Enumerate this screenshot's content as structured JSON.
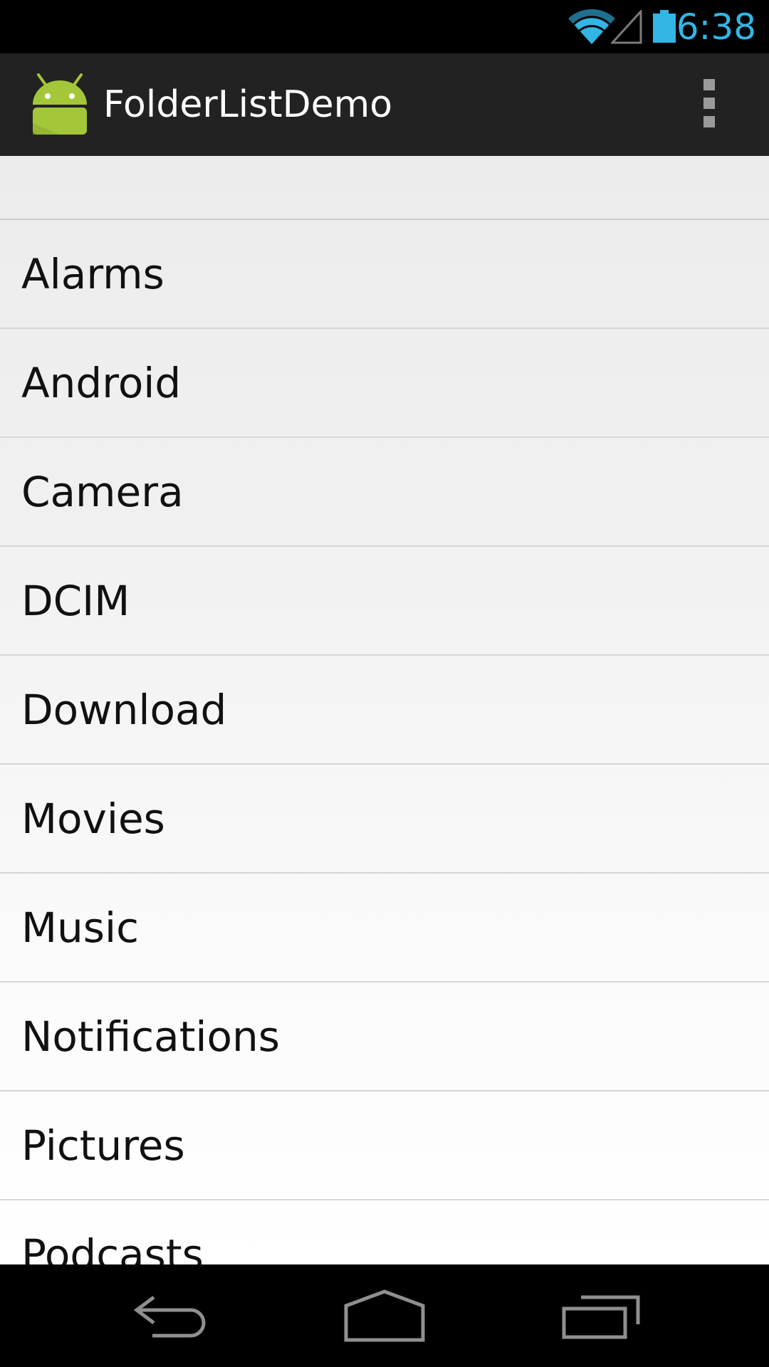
{
  "status_bar": {
    "time": "6:38",
    "icons": [
      "wifi-icon",
      "cell-signal-icon",
      "battery-icon"
    ],
    "accent_color": "#33b5e5"
  },
  "action_bar": {
    "title": "FolderListDemo",
    "app_icon": "android-robot-icon",
    "overflow_icon": "overflow-menu-icon"
  },
  "folder_list": {
    "items": [
      "Alarms",
      "Android",
      "Camera",
      "DCIM",
      "Download",
      "Movies",
      "Music",
      "Notifications",
      "Pictures",
      "Podcasts"
    ]
  },
  "nav_bar": {
    "icons": [
      "back-icon",
      "home-icon",
      "recent-apps-icon"
    ]
  }
}
